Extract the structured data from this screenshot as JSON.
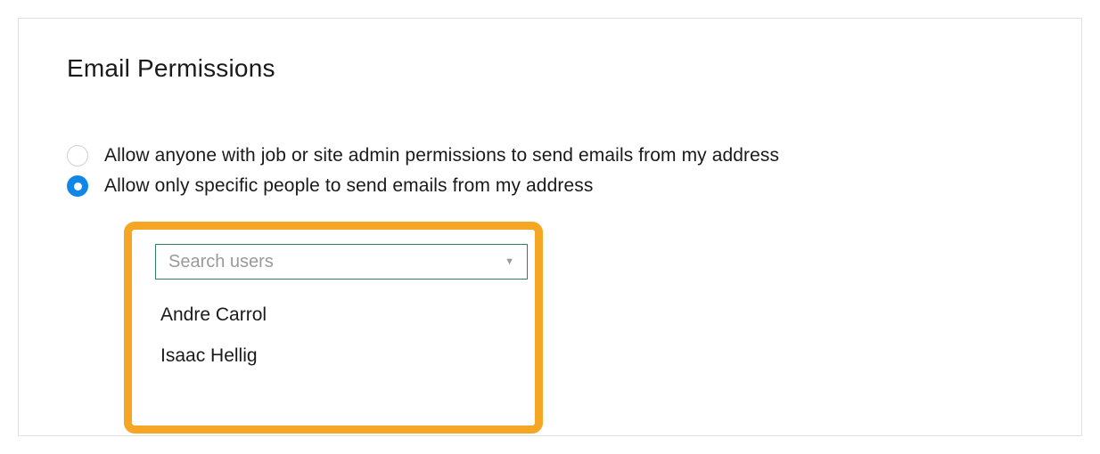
{
  "panel": {
    "title": "Email Permissions"
  },
  "options": {
    "anyone": {
      "label": "Allow anyone with job or site admin permissions to send emails from my address"
    },
    "specific": {
      "label": "Allow only specific people to send emails from my address"
    }
  },
  "search": {
    "placeholder": "Search users"
  },
  "users": [
    "Andre Carrol",
    "Isaac Hellig"
  ],
  "colors": {
    "accent_blue": "#0f86e8",
    "highlight_orange": "#f5a623",
    "select_border": "#2e8060"
  }
}
